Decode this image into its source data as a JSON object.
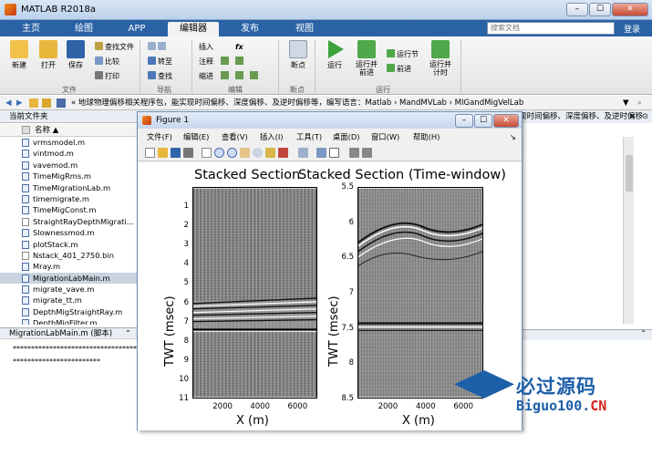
{
  "window": {
    "title": "MATLAB R2018a",
    "buttons": [
      "–",
      "☐",
      "✕"
    ]
  },
  "ribbon_tabs": [
    "主页",
    "绘图",
    "APP",
    "编辑器",
    "发布",
    "视图"
  ],
  "search": {
    "placeholder": "搜索文档"
  },
  "login": "登录",
  "ribbon": {
    "file": {
      "new": "新建",
      "open": "打开",
      "save": "保存",
      "find_files": "查找文件",
      "compare": "比较",
      "print": "打印",
      "label": "文件"
    },
    "navigate": {
      "goto": "转至",
      "find": "查找",
      "label": "导航"
    },
    "edit": {
      "insert": "插入",
      "fx": "fx",
      "comment": "注释",
      "indent": "缩进",
      "label": "编辑"
    },
    "breakpoints": {
      "breakpoint": "断点",
      "label": "断点"
    },
    "run": {
      "run": "运行",
      "run_advance": "运行并\n前进",
      "run_section": "运行节",
      "advance": "前进",
      "run_time": "运行并\n计时",
      "label": "运行"
    }
  },
  "address": {
    "path": "« 地球物理偏移相关程序包，能实现时间偏移、深度偏移、及逆时偏移等，编写语言：Matlab › MandMVLab › MIGandMigVelLab"
  },
  "current_folder": {
    "title": "当前文件夹",
    "column": "名称 ▲",
    "files": [
      "vrmsmodel.m",
      "vintmod.m",
      "vavemod.m",
      "TimeMigRms.m",
      "TimeMigrationLab.m",
      "timemigrate.m",
      "TimeMigConst.m",
      "StraightRayDepthMigrati...",
      "Slownessmod.m",
      "plotStack.m",
      "Nstack_401_2750.bin",
      "Mray.m",
      "MigrationLabMain.m",
      "migrate_vave.m",
      "migrate_tt.m",
      "DepthMigStraightRay.m",
      "DepthMigFilter.m"
    ],
    "selected_index": 12
  },
  "details": {
    "title": "MigrationLabMain.m  (脚本)",
    "lines": [
      "**************************************",
      "************************"
    ]
  },
  "right_panel": {
    "header": "现时间偏移、深度偏移、及逆时偏移"
  },
  "figure": {
    "title": "Figure 1",
    "menu": [
      "文件(F)",
      "编辑(E)",
      "查看(V)",
      "插入(I)",
      "工具(T)",
      "桌面(D)",
      "窗口(W)",
      "帮助(H)"
    ],
    "plots": [
      {
        "title": "Stacked Section",
        "ylabel": "TWT (msec)",
        "xlabel": "X (m)",
        "yticks": [
          "1",
          "2",
          "3",
          "4",
          "5",
          "6",
          "7",
          "8",
          "9",
          "10",
          "11"
        ],
        "xticks": [
          "2000",
          "4000",
          "6000"
        ]
      },
      {
        "title": "Stacked Section (Time-window)",
        "ylabel": "TWT (msec)",
        "xlabel": "X (m)",
        "yticks": [
          "5.5",
          "6",
          "6.5",
          "7",
          "7.5",
          "8",
          "8.5"
        ],
        "xticks": [
          "2000",
          "4000",
          "6000"
        ]
      }
    ]
  },
  "watermark": {
    "text": "必过源码",
    "url_main": "Biguo100.",
    "url_suffix": "CN"
  }
}
